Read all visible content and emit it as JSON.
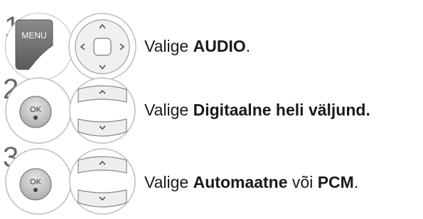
{
  "steps": [
    {
      "number": "1",
      "key": "MENU",
      "control": "dpad",
      "parts": [
        {
          "text": "Valige ",
          "bold": false
        },
        {
          "text": "AUDIO",
          "bold": true
        },
        {
          "text": ".",
          "bold": false
        }
      ]
    },
    {
      "number": "2",
      "key": "OK",
      "control": "updown",
      "parts": [
        {
          "text": "Valige ",
          "bold": false
        },
        {
          "text": "Digitaalne heli väljund.",
          "bold": true
        }
      ]
    },
    {
      "number": "3",
      "key": "OK",
      "control": "updown",
      "parts": [
        {
          "text": "Valige ",
          "bold": false
        },
        {
          "text": "Automaatne",
          "bold": true
        },
        {
          "text": " või ",
          "bold": false
        },
        {
          "text": "PCM",
          "bold": true
        },
        {
          "text": ".",
          "bold": false
        }
      ]
    }
  ],
  "icons": {
    "menu_button": "menu-key-icon",
    "ok_button": "ok-key-icon",
    "dpad": "navigation-dpad-icon",
    "updown": "up-down-keys-icon"
  },
  "colors": {
    "key_dark": "#6e6e6e",
    "key_light": "#d8d8d8",
    "ring": "#bdbdbd",
    "text": "#1a1a1a"
  }
}
